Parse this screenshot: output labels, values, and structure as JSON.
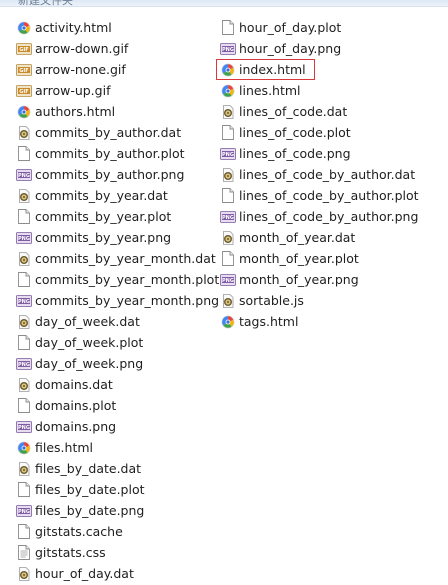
{
  "window": {
    "header_text": "新建文件夹"
  },
  "files_left": [
    {
      "name": "activity.html",
      "icon": "html-file-icon"
    },
    {
      "name": "arrow-down.gif",
      "icon": "gif-file-icon"
    },
    {
      "name": "arrow-none.gif",
      "icon": "gif-file-icon"
    },
    {
      "name": "arrow-up.gif",
      "icon": "gif-file-icon"
    },
    {
      "name": "authors.html",
      "icon": "html-file-icon"
    },
    {
      "name": "commits_by_author.dat",
      "icon": "dat-file-icon"
    },
    {
      "name": "commits_by_author.plot",
      "icon": "blank-file-icon"
    },
    {
      "name": "commits_by_author.png",
      "icon": "png-file-icon"
    },
    {
      "name": "commits_by_year.dat",
      "icon": "dat-file-icon"
    },
    {
      "name": "commits_by_year.plot",
      "icon": "blank-file-icon"
    },
    {
      "name": "commits_by_year.png",
      "icon": "png-file-icon"
    },
    {
      "name": "commits_by_year_month.dat",
      "icon": "dat-file-icon"
    },
    {
      "name": "commits_by_year_month.plot",
      "icon": "blank-file-icon"
    },
    {
      "name": "commits_by_year_month.png",
      "icon": "png-file-icon"
    },
    {
      "name": "day_of_week.dat",
      "icon": "dat-file-icon"
    },
    {
      "name": "day_of_week.plot",
      "icon": "blank-file-icon"
    },
    {
      "name": "day_of_week.png",
      "icon": "png-file-icon"
    },
    {
      "name": "domains.dat",
      "icon": "dat-file-icon"
    },
    {
      "name": "domains.plot",
      "icon": "blank-file-icon"
    },
    {
      "name": "domains.png",
      "icon": "png-file-icon"
    },
    {
      "name": "files.html",
      "icon": "html-file-icon"
    },
    {
      "name": "files_by_date.dat",
      "icon": "dat-file-icon"
    },
    {
      "name": "files_by_date.plot",
      "icon": "blank-file-icon"
    },
    {
      "name": "files_by_date.png",
      "icon": "png-file-icon"
    },
    {
      "name": "gitstats.cache",
      "icon": "blank-file-icon"
    },
    {
      "name": "gitstats.css",
      "icon": "css-file-icon"
    },
    {
      "name": "hour_of_day.dat",
      "icon": "dat-file-icon"
    }
  ],
  "files_right": [
    {
      "name": "hour_of_day.plot",
      "icon": "blank-file-icon"
    },
    {
      "name": "hour_of_day.png",
      "icon": "png-file-icon"
    },
    {
      "name": "index.html",
      "icon": "html-file-icon",
      "selected": true
    },
    {
      "name": "lines.html",
      "icon": "html-file-icon"
    },
    {
      "name": "lines_of_code.dat",
      "icon": "dat-file-icon"
    },
    {
      "name": "lines_of_code.plot",
      "icon": "blank-file-icon"
    },
    {
      "name": "lines_of_code.png",
      "icon": "png-file-icon"
    },
    {
      "name": "lines_of_code_by_author.dat",
      "icon": "dat-file-icon"
    },
    {
      "name": "lines_of_code_by_author.plot",
      "icon": "blank-file-icon"
    },
    {
      "name": "lines_of_code_by_author.png",
      "icon": "png-file-icon"
    },
    {
      "name": "month_of_year.dat",
      "icon": "dat-file-icon"
    },
    {
      "name": "month_of_year.plot",
      "icon": "blank-file-icon"
    },
    {
      "name": "month_of_year.png",
      "icon": "png-file-icon"
    },
    {
      "name": "sortable.js",
      "icon": "dat-file-icon"
    },
    {
      "name": "tags.html",
      "icon": "html-file-icon"
    }
  ],
  "colors": {
    "selection_border": "#d9393b",
    "text": "#1e1e1e"
  }
}
